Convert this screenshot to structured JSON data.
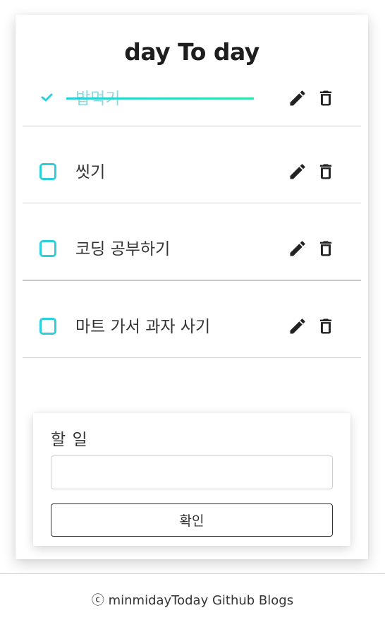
{
  "app": {
    "title": "day To day"
  },
  "todos": [
    {
      "text": "밥먹기",
      "done": true
    },
    {
      "text": "씻기",
      "done": false
    },
    {
      "text": "코딩 공부하기",
      "done": false
    },
    {
      "text": "마트 가서 과자 사기",
      "done": false
    }
  ],
  "icons": {
    "check": "check-icon",
    "edit": "pencil-icon",
    "delete": "trash-icon"
  },
  "colors": {
    "accent": "#2ad0dc",
    "accent_end": "#30e5a8",
    "done_text": "#8ed9e0"
  },
  "form": {
    "label": "할 일",
    "input_value": "",
    "submit_label": "확인"
  },
  "footer": {
    "text": "ⓒ minmidayToday Github Blogs"
  }
}
